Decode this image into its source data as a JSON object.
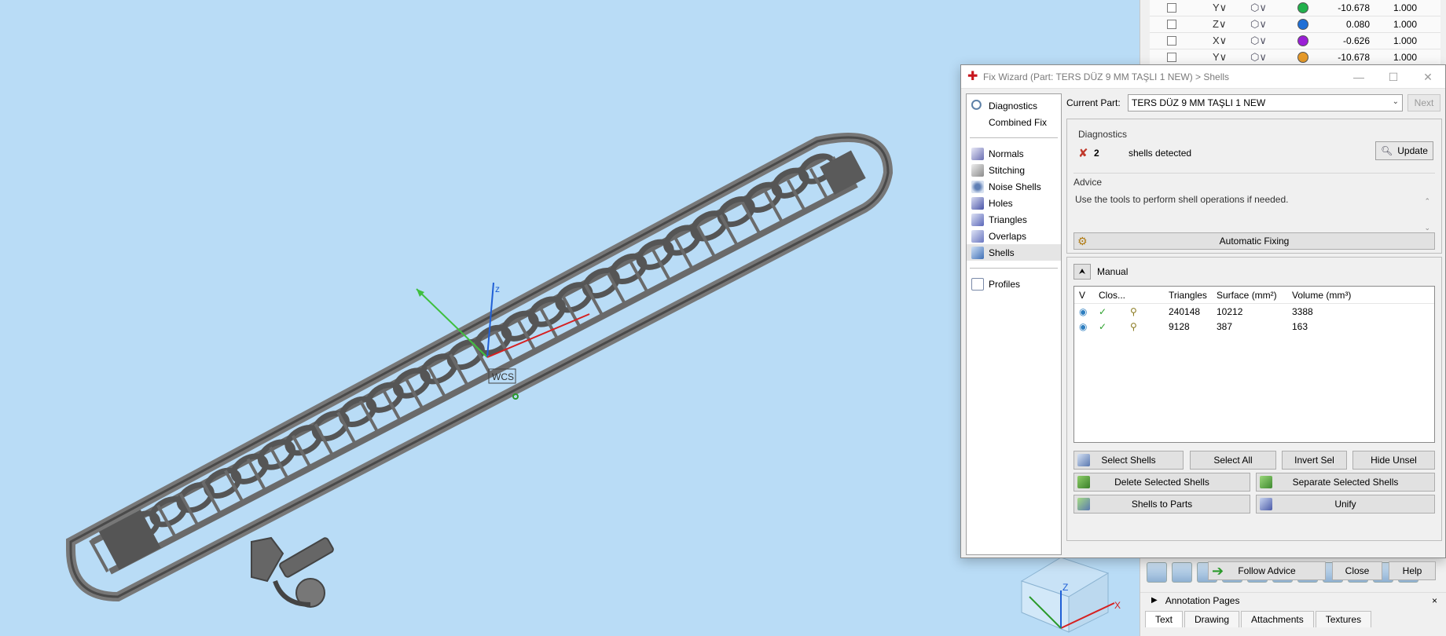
{
  "viewport": {
    "axis_z": "z",
    "axis_label": "WCS",
    "navcube_z": "Z",
    "navcube_x": "X"
  },
  "parts_table": {
    "rows": [
      {
        "axis": "Y∨",
        "dot_color": "#22b14c",
        "value": "-10.678",
        "scale": "1.000"
      },
      {
        "axis": "Z∨",
        "dot_color": "#1f6fd6",
        "value": "0.080",
        "scale": "1.000"
      },
      {
        "axis": "X∨",
        "dot_color": "#9b1fd6",
        "value": "-0.626",
        "scale": "1.000"
      },
      {
        "axis": "Y∨",
        "dot_color": "#e69a2a",
        "value": "-10.678",
        "scale": "1.000"
      }
    ]
  },
  "annotation": {
    "label": "Annotation Pages",
    "close": "×",
    "tabs": [
      "Text",
      "Drawing",
      "Attachments",
      "Textures"
    ]
  },
  "dialog": {
    "title": "Fix Wizard (Part: TERS DÜZ 9 MM TAŞLI 1 NEW) > Shells",
    "min": "—",
    "max": "☐",
    "close": "✕",
    "nav": {
      "group1": [
        {
          "label": "Diagnostics",
          "icon": "magnifier-icon"
        },
        {
          "label": "Combined Fix",
          "icon": "blank-icon"
        }
      ],
      "group2": [
        {
          "label": "Normals",
          "icon": "normals-icon"
        },
        {
          "label": "Stitching",
          "icon": "stitching-icon"
        },
        {
          "label": "Noise Shells",
          "icon": "noise-shells-icon"
        },
        {
          "label": "Holes",
          "icon": "holes-icon"
        },
        {
          "label": "Triangles",
          "icon": "triangles-icon"
        },
        {
          "label": "Overlaps",
          "icon": "overlaps-icon"
        },
        {
          "label": "Shells",
          "icon": "shells-icon"
        }
      ],
      "group3": [
        {
          "label": "Profiles",
          "icon": "profiles-icon"
        }
      ]
    },
    "current_part_label": "Current Part:",
    "current_part_value": "TERS DÜZ 9 MM TAŞLI 1 NEW",
    "next_label": "Next",
    "diagnostics": {
      "title": "Diagnostics",
      "count": "2",
      "message": "shells detected",
      "update_label": "Update"
    },
    "advice": {
      "title": "Advice",
      "text": "Use the tools to perform shell operations if needed."
    },
    "auto_fix_label": "Automatic Fixing",
    "manual": {
      "title": "Manual",
      "columns": [
        "V",
        "Clos...",
        "",
        "Triangles",
        "Surface (mm²)",
        "Volume (mm³)"
      ],
      "rows": [
        {
          "triangles": "240148",
          "surface": "10212",
          "volume": "3388"
        },
        {
          "triangles": "9128",
          "surface": "387",
          "volume": "163"
        }
      ],
      "buttons": {
        "select_shells": "Select Shells",
        "select_all": "Select All",
        "invert_sel": "Invert Sel",
        "hide_unsel": "Hide Unsel",
        "delete_selected": "Delete Selected Shells",
        "separate_selected": "Separate Selected Shells",
        "shells_to_parts": "Shells to Parts",
        "unify": "Unify"
      }
    },
    "footer": {
      "follow_advice": "Follow Advice",
      "close": "Close",
      "help": "Help"
    }
  }
}
